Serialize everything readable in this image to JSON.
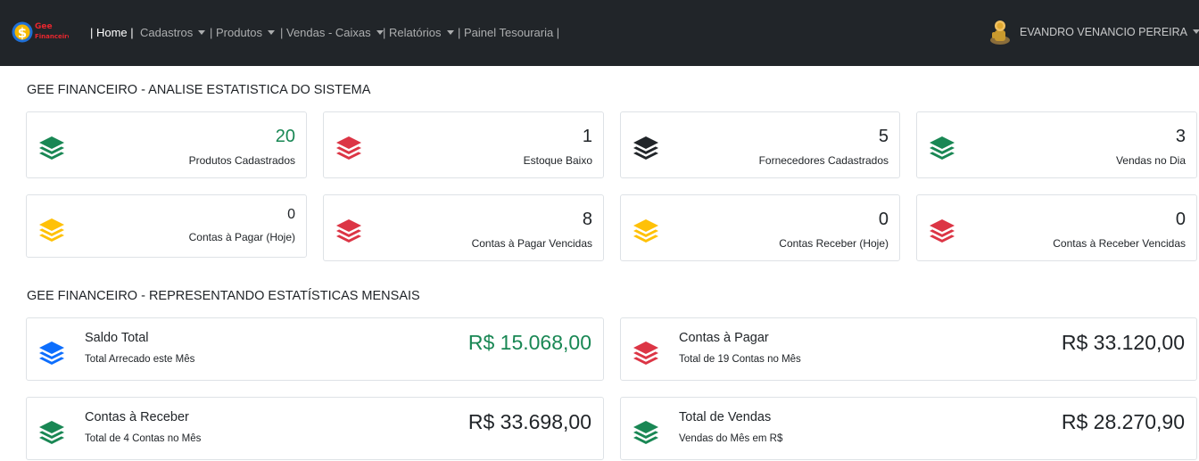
{
  "brand": {
    "line1": "Gee",
    "line2": "Financeiro"
  },
  "nav": {
    "home": "| Home |",
    "cadastros": "Cadastros",
    "produtos": "| Produtos",
    "vendas_caixas": "| Vendas - Caixas",
    "relatorios": "| Relatórios",
    "painel_tesouraria": "| Painel Tesouraria |"
  },
  "user": {
    "name": "EVANDRO VENANCIO PEREIRA"
  },
  "colors": {
    "green": "#198754",
    "red": "#dc3545",
    "dark": "#212529",
    "yellow": "#ffc107",
    "blue": "#0d6efd",
    "navbar": "#212529"
  },
  "section1": {
    "title": "GEE FINANCEIRO - ANALISE ESTATISTICA DO SISTEMA",
    "cards": [
      {
        "value": "20",
        "label": "Produtos Cadastrados",
        "icon": "layers-icon-green"
      },
      {
        "value": "1",
        "label": "Estoque Baixo",
        "icon": "layers-icon-red"
      },
      {
        "value": "5",
        "label": "Fornecedores Cadastrados",
        "icon": "layers-icon-dark"
      },
      {
        "value": "3",
        "label": "Vendas no Dia",
        "icon": "layers-icon-green"
      },
      {
        "value": "0",
        "label": "Contas à Pagar (Hoje)",
        "icon": "layers-icon-yellow"
      },
      {
        "value": "8",
        "label": "Contas à Pagar Vencidas",
        "icon": "layers-icon-red"
      },
      {
        "value": "0",
        "label": "Contas Receber (Hoje)",
        "icon": "layers-icon-yellow"
      },
      {
        "value": "0",
        "label": "Contas à Receber Vencidas",
        "icon": "layers-icon-red"
      }
    ]
  },
  "section2": {
    "title": "GEE FINANCEIRO - REPRESENTANDO ESTATÍSTICAS MENSAIS",
    "cards": [
      {
        "title": "Saldo Total",
        "subtitle": "Total Arrecado este Mês",
        "value": "R$ 15.068,00",
        "icon": "layers-icon-blue"
      },
      {
        "title": "Contas à Pagar",
        "subtitle": "Total de 19 Contas no Mês",
        "value": "R$ 33.120,00",
        "icon": "layers-icon-red"
      },
      {
        "title": "Contas à Receber",
        "subtitle": "Total de 4 Contas no Mês",
        "value": "R$ 33.698,00",
        "icon": "layers-icon-green"
      },
      {
        "title": "Total de Vendas",
        "subtitle": "Vendas do Mês em R$",
        "value": "R$ 28.270,90",
        "icon": "layers-icon-green"
      }
    ]
  }
}
